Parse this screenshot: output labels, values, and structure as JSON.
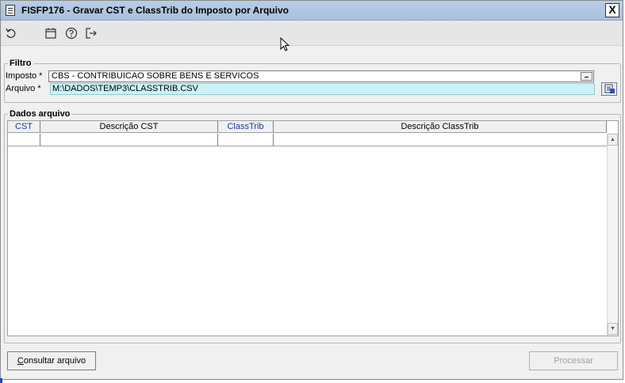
{
  "window": {
    "title": "FISFP176 - Gravar CST e ClassTrib do Imposto por Arquivo",
    "close_label": "X"
  },
  "toolbar": {
    "icons": [
      "undo-icon",
      "calendar-icon",
      "help-icon",
      "exit-icon"
    ]
  },
  "filtro": {
    "legend": "Filtro",
    "imposto_label": "Imposto *",
    "imposto_value": "CBS - CONTRIBUICAO SOBRE BENS E SERVICOS",
    "arquivo_label": "Arquivo *",
    "arquivo_value": "M:\\DADOS\\TEMP3\\CLASSTRIB.CSV"
  },
  "dados": {
    "legend": "Dados arquivo",
    "columns": [
      "CST",
      "Descrição CST",
      "ClassTrib",
      "Descrição ClassTrib"
    ],
    "rows": []
  },
  "buttons": {
    "consultar": "Consultar arquivo",
    "processar": "Processar"
  },
  "colors": {
    "titlebar": "#b9cde5",
    "path_field": "#c8f4f7",
    "key_header_text": "#1a3aa0"
  }
}
